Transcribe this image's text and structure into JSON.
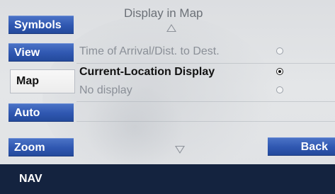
{
  "screen": {
    "title": "Display in Map"
  },
  "sidebar": {
    "items": [
      {
        "label": "Symbols",
        "active": false
      },
      {
        "label": "View",
        "active": false
      },
      {
        "label": "Map",
        "active": true
      },
      {
        "label": "Auto",
        "active": false
      },
      {
        "label": "Zoom",
        "active": false
      }
    ]
  },
  "options": [
    {
      "label": "Time of Arrival/Dist. to Dest.",
      "selected": false
    },
    {
      "label": "Current-Location Display",
      "selected": true
    },
    {
      "label": "No display",
      "selected": false
    }
  ],
  "buttons": {
    "back_label": "Back"
  },
  "status_bar": {
    "mode": "NAV"
  },
  "colors": {
    "button_blue": "#2f57b0",
    "status_bar": "#14233f",
    "background": "#dfe1e4"
  }
}
